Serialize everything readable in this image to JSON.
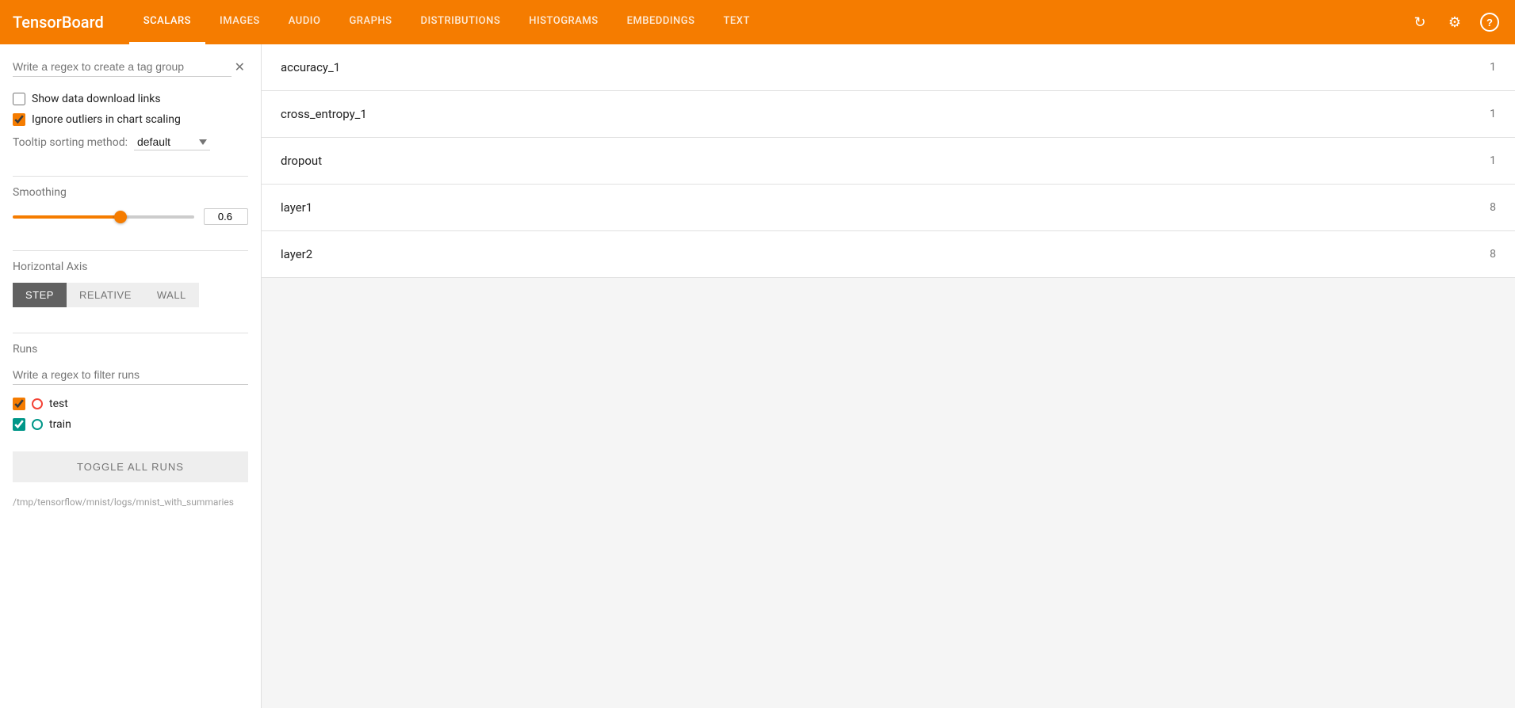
{
  "brand": "TensorBoard",
  "nav": {
    "links": [
      {
        "id": "scalars",
        "label": "SCALARS",
        "active": true
      },
      {
        "id": "images",
        "label": "IMAGES",
        "active": false
      },
      {
        "id": "audio",
        "label": "AUDIO",
        "active": false
      },
      {
        "id": "graphs",
        "label": "GRAPHS",
        "active": false
      },
      {
        "id": "distributions",
        "label": "DISTRIBUTIONS",
        "active": false
      },
      {
        "id": "histograms",
        "label": "HISTOGRAMS",
        "active": false
      },
      {
        "id": "embeddings",
        "label": "EMBEDDINGS",
        "active": false
      },
      {
        "id": "text",
        "label": "TEXT",
        "active": false
      }
    ]
  },
  "sidebar": {
    "tag_regex_placeholder": "Write a regex to create a tag group",
    "show_download_label": "Show data download links",
    "ignore_outliers_label": "Ignore outliers in chart scaling",
    "tooltip_label": "Tooltip sorting method:",
    "tooltip_default": "default",
    "smoothing_label": "Smoothing",
    "smoothing_value": "0.6",
    "axis_label": "Horizontal Axis",
    "axis_buttons": [
      {
        "id": "step",
        "label": "STEP",
        "active": true
      },
      {
        "id": "relative",
        "label": "RELATIVE",
        "active": false
      },
      {
        "id": "wall",
        "label": "WALL",
        "active": false
      }
    ],
    "runs_label": "Runs",
    "filter_runs_placeholder": "Write a regex to filter runs",
    "runs": [
      {
        "id": "test",
        "label": "test",
        "color": "#f44336",
        "checked": true,
        "color_type": "orange"
      },
      {
        "id": "train",
        "label": "train",
        "color": "#009688",
        "checked": true,
        "color_type": "teal"
      }
    ],
    "toggle_all_label": "TOGGLE ALL RUNS",
    "logdir": "/tmp/tensorflow/mnist/logs/mnist_with_summaries"
  },
  "main": {
    "tags": [
      {
        "id": "accuracy_1",
        "name": "accuracy_1",
        "count": "1"
      },
      {
        "id": "cross_entropy_1",
        "name": "cross_entropy_1",
        "count": "1"
      },
      {
        "id": "dropout",
        "name": "dropout",
        "count": "1"
      },
      {
        "id": "layer1",
        "name": "layer1",
        "count": "8"
      },
      {
        "id": "layer2",
        "name": "layer2",
        "count": "8"
      }
    ]
  },
  "icons": {
    "close": "✕",
    "refresh": "↻",
    "settings": "⚙",
    "help": "?"
  }
}
